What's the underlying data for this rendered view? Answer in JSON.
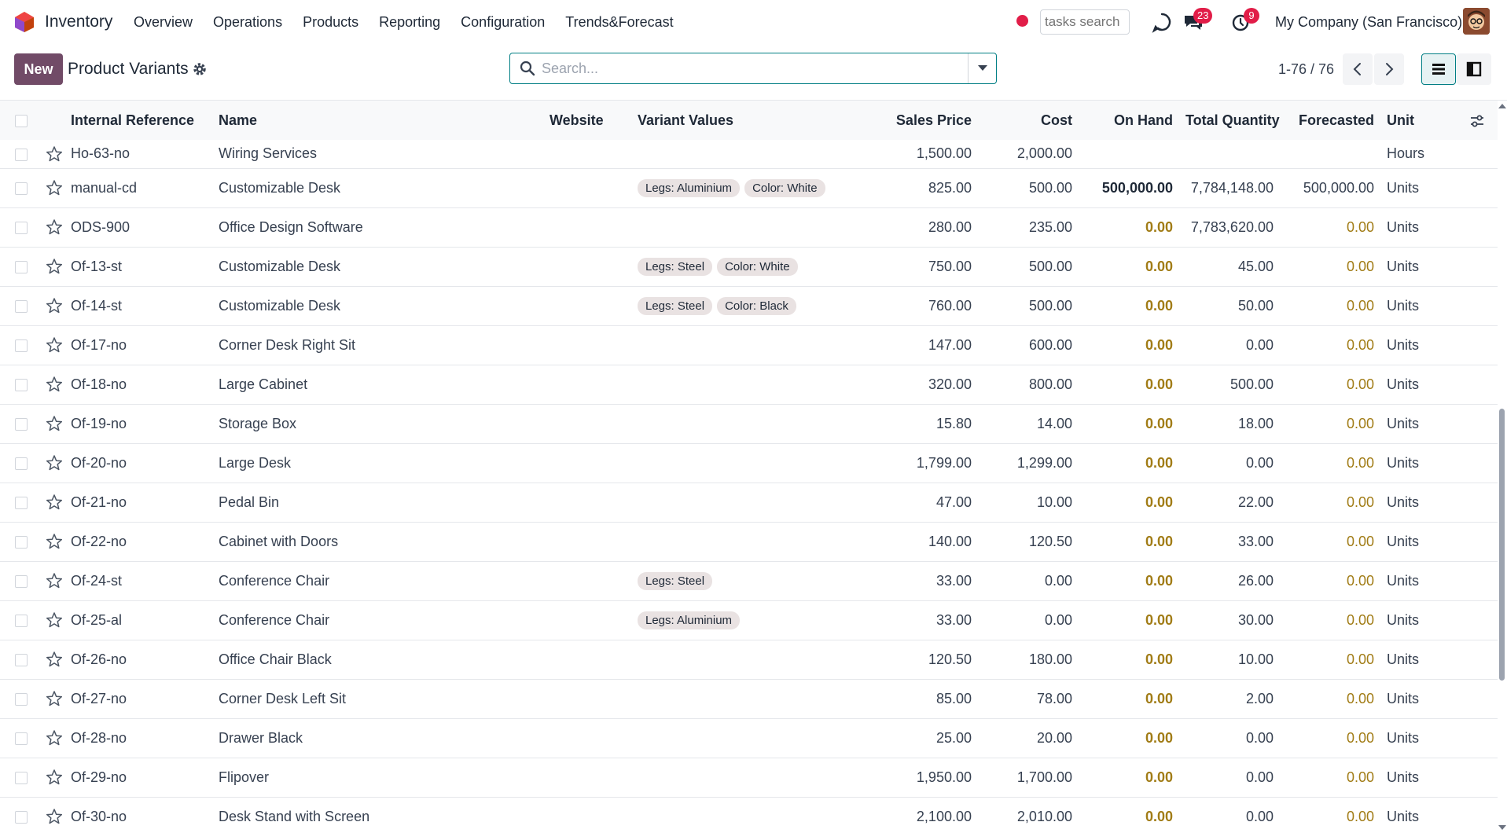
{
  "navbar": {
    "app_name": "Inventory",
    "menu": [
      "Overview",
      "Operations",
      "Products",
      "Reporting",
      "Configuration",
      "Trends&Forecast"
    ],
    "tasks_search_placeholder": "tasks search",
    "messages_count": "23",
    "activities_count": "9",
    "company": "My Company (San Francisco)"
  },
  "control": {
    "new_label": "New",
    "title": "Product Variants",
    "search_placeholder": "Search...",
    "pager": "1-76 / 76"
  },
  "table": {
    "headers": {
      "internal_reference": "Internal Reference",
      "name": "Name",
      "website": "Website",
      "variant_values": "Variant Values",
      "sales_price": "Sales Price",
      "cost": "Cost",
      "on_hand": "On Hand",
      "total_quantity": "Total Quantity",
      "forecasted": "Forecasted",
      "unit": "Unit"
    },
    "rows": [
      {
        "ref": "Ho-63-no",
        "name": "Wiring Services",
        "tags": [],
        "price": "1,500.00",
        "cost": "2,000.00",
        "on_hand": "",
        "total": "",
        "forecast": "",
        "unit": "Hours"
      },
      {
        "ref": "manual-cd",
        "name": "Customizable Desk",
        "tags": [
          "Legs: Aluminium",
          "Color: White"
        ],
        "price": "825.00",
        "cost": "500.00",
        "on_hand": "500,000.00",
        "total": "7,784,148.00",
        "forecast": "500,000.00",
        "unit": "Units"
      },
      {
        "ref": "ODS-900",
        "name": "Office Design Software",
        "tags": [],
        "price": "280.00",
        "cost": "235.00",
        "on_hand": "0.00",
        "total": "7,783,620.00",
        "forecast": "0.00",
        "unit": "Units"
      },
      {
        "ref": "Of-13-st",
        "name": "Customizable Desk",
        "tags": [
          "Legs: Steel",
          "Color: White"
        ],
        "price": "750.00",
        "cost": "500.00",
        "on_hand": "0.00",
        "total": "45.00",
        "forecast": "0.00",
        "unit": "Units"
      },
      {
        "ref": "Of-14-st",
        "name": "Customizable Desk",
        "tags": [
          "Legs: Steel",
          "Color: Black"
        ],
        "price": "760.00",
        "cost": "500.00",
        "on_hand": "0.00",
        "total": "50.00",
        "forecast": "0.00",
        "unit": "Units"
      },
      {
        "ref": "Of-17-no",
        "name": "Corner Desk Right Sit",
        "tags": [],
        "price": "147.00",
        "cost": "600.00",
        "on_hand": "0.00",
        "total": "0.00",
        "forecast": "0.00",
        "unit": "Units"
      },
      {
        "ref": "Of-18-no",
        "name": "Large Cabinet",
        "tags": [],
        "price": "320.00",
        "cost": "800.00",
        "on_hand": "0.00",
        "total": "500.00",
        "forecast": "0.00",
        "unit": "Units"
      },
      {
        "ref": "Of-19-no",
        "name": "Storage Box",
        "tags": [],
        "price": "15.80",
        "cost": "14.00",
        "on_hand": "0.00",
        "total": "18.00",
        "forecast": "0.00",
        "unit": "Units"
      },
      {
        "ref": "Of-20-no",
        "name": "Large Desk",
        "tags": [],
        "price": "1,799.00",
        "cost": "1,299.00",
        "on_hand": "0.00",
        "total": "0.00",
        "forecast": "0.00",
        "unit": "Units"
      },
      {
        "ref": "Of-21-no",
        "name": "Pedal Bin",
        "tags": [],
        "price": "47.00",
        "cost": "10.00",
        "on_hand": "0.00",
        "total": "22.00",
        "forecast": "0.00",
        "unit": "Units"
      },
      {
        "ref": "Of-22-no",
        "name": "Cabinet with Doors",
        "tags": [],
        "price": "140.00",
        "cost": "120.50",
        "on_hand": "0.00",
        "total": "33.00",
        "forecast": "0.00",
        "unit": "Units"
      },
      {
        "ref": "Of-24-st",
        "name": "Conference Chair",
        "tags": [
          "Legs: Steel"
        ],
        "price": "33.00",
        "cost": "0.00",
        "on_hand": "0.00",
        "total": "26.00",
        "forecast": "0.00",
        "unit": "Units"
      },
      {
        "ref": "Of-25-al",
        "name": "Conference Chair",
        "tags": [
          "Legs: Aluminium"
        ],
        "price": "33.00",
        "cost": "0.00",
        "on_hand": "0.00",
        "total": "30.00",
        "forecast": "0.00",
        "unit": "Units"
      },
      {
        "ref": "Of-26-no",
        "name": "Office Chair Black",
        "tags": [],
        "price": "120.50",
        "cost": "180.00",
        "on_hand": "0.00",
        "total": "10.00",
        "forecast": "0.00",
        "unit": "Units"
      },
      {
        "ref": "Of-27-no",
        "name": "Corner Desk Left Sit",
        "tags": [],
        "price": "85.00",
        "cost": "78.00",
        "on_hand": "0.00",
        "total": "2.00",
        "forecast": "0.00",
        "unit": "Units"
      },
      {
        "ref": "Of-28-no",
        "name": "Drawer Black",
        "tags": [],
        "price": "25.00",
        "cost": "20.00",
        "on_hand": "0.00",
        "total": "0.00",
        "forecast": "0.00",
        "unit": "Units"
      },
      {
        "ref": "Of-29-no",
        "name": "Flipover",
        "tags": [],
        "price": "1,950.00",
        "cost": "1,700.00",
        "on_hand": "0.00",
        "total": "0.00",
        "forecast": "0.00",
        "unit": "Units"
      },
      {
        "ref": "Of-30-no",
        "name": "Desk Stand with Screen",
        "tags": [],
        "price": "2,100.00",
        "cost": "2,010.00",
        "on_hand": "0.00",
        "total": "0.00",
        "forecast": "0.00",
        "unit": "Units"
      }
    ]
  },
  "colors": {
    "brand": "#714b67",
    "accent": "#017e84",
    "zero_value": "#a17c16",
    "badge": "#e11d48"
  },
  "icons": [
    "odoo-logo-icon",
    "record-dot-icon",
    "discuss-icon",
    "chat-icon",
    "clock-icon",
    "gear-icon",
    "search-icon",
    "chevron-left-icon",
    "chevron-right-icon",
    "list-view-icon",
    "kanban-view-icon",
    "star-icon",
    "column-settings-icon"
  ]
}
